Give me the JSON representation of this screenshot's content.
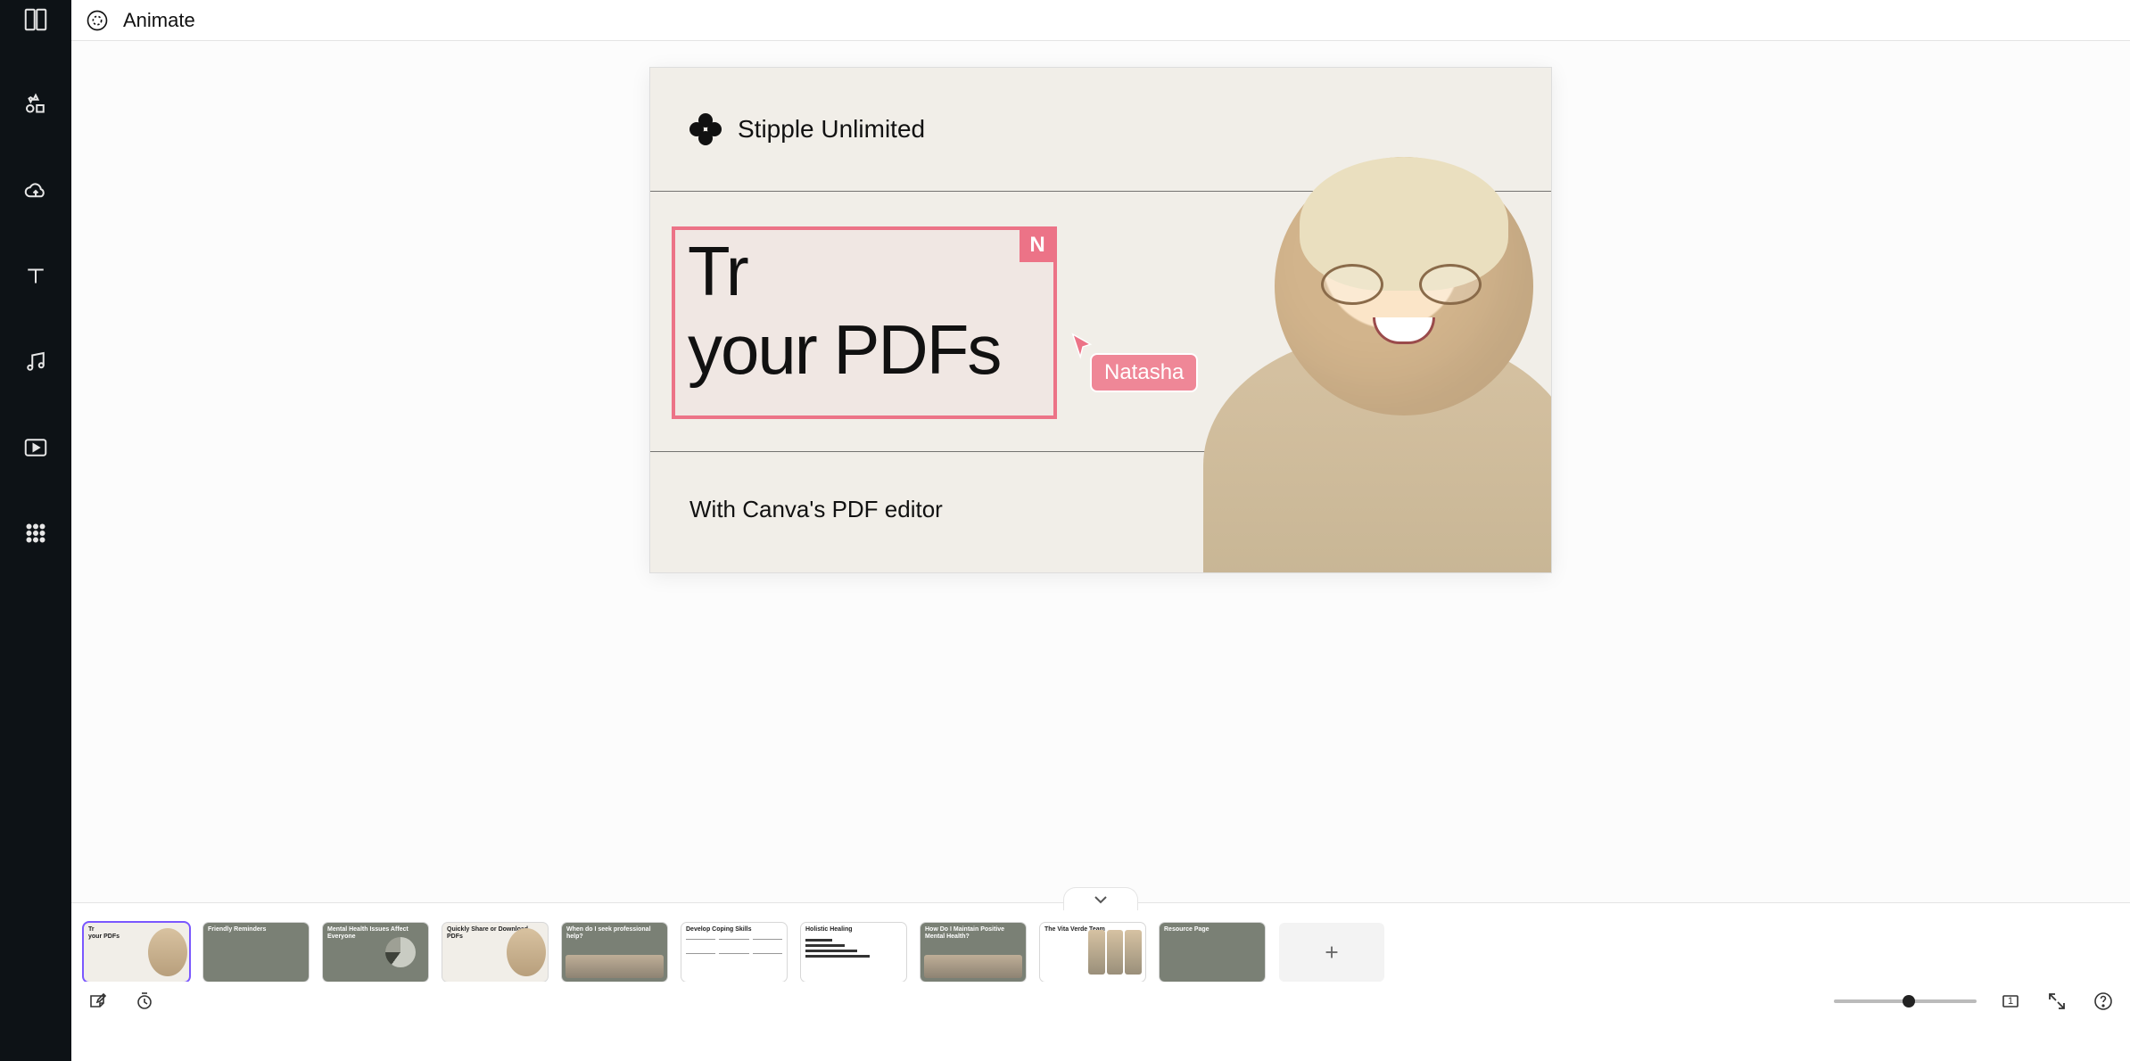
{
  "toolbar": {
    "animate_label": "Animate"
  },
  "slide": {
    "brand": "Stipple Unlimited",
    "line1": "Tr",
    "line2": "your PDFs",
    "collab_initial": "N",
    "collab_name": "Natasha",
    "subtitle": "With Canva's PDF editor"
  },
  "thumbnails": [
    {
      "title": "Tr\nyour PDFs",
      "variant": "sel"
    },
    {
      "title": "Friendly Reminders",
      "variant": "grey"
    },
    {
      "title": "Mental Health Issues Affect Everyone",
      "variant": "grey-pie"
    },
    {
      "title": "Quickly Share or Download PDFs",
      "variant": "split"
    },
    {
      "title": "When do I seek professional help?",
      "variant": "grey-photo"
    },
    {
      "title": "Develop Coping Skills",
      "variant": "cols"
    },
    {
      "title": "Holistic Healing",
      "variant": "bars"
    },
    {
      "title": "How Do I Maintain Positive Mental Health?",
      "variant": "grey-face"
    },
    {
      "title": "The Vita Verde Team",
      "variant": "people"
    },
    {
      "title": "Resource Page",
      "variant": "grey"
    }
  ],
  "bottom": {
    "page_indicator": "1"
  }
}
